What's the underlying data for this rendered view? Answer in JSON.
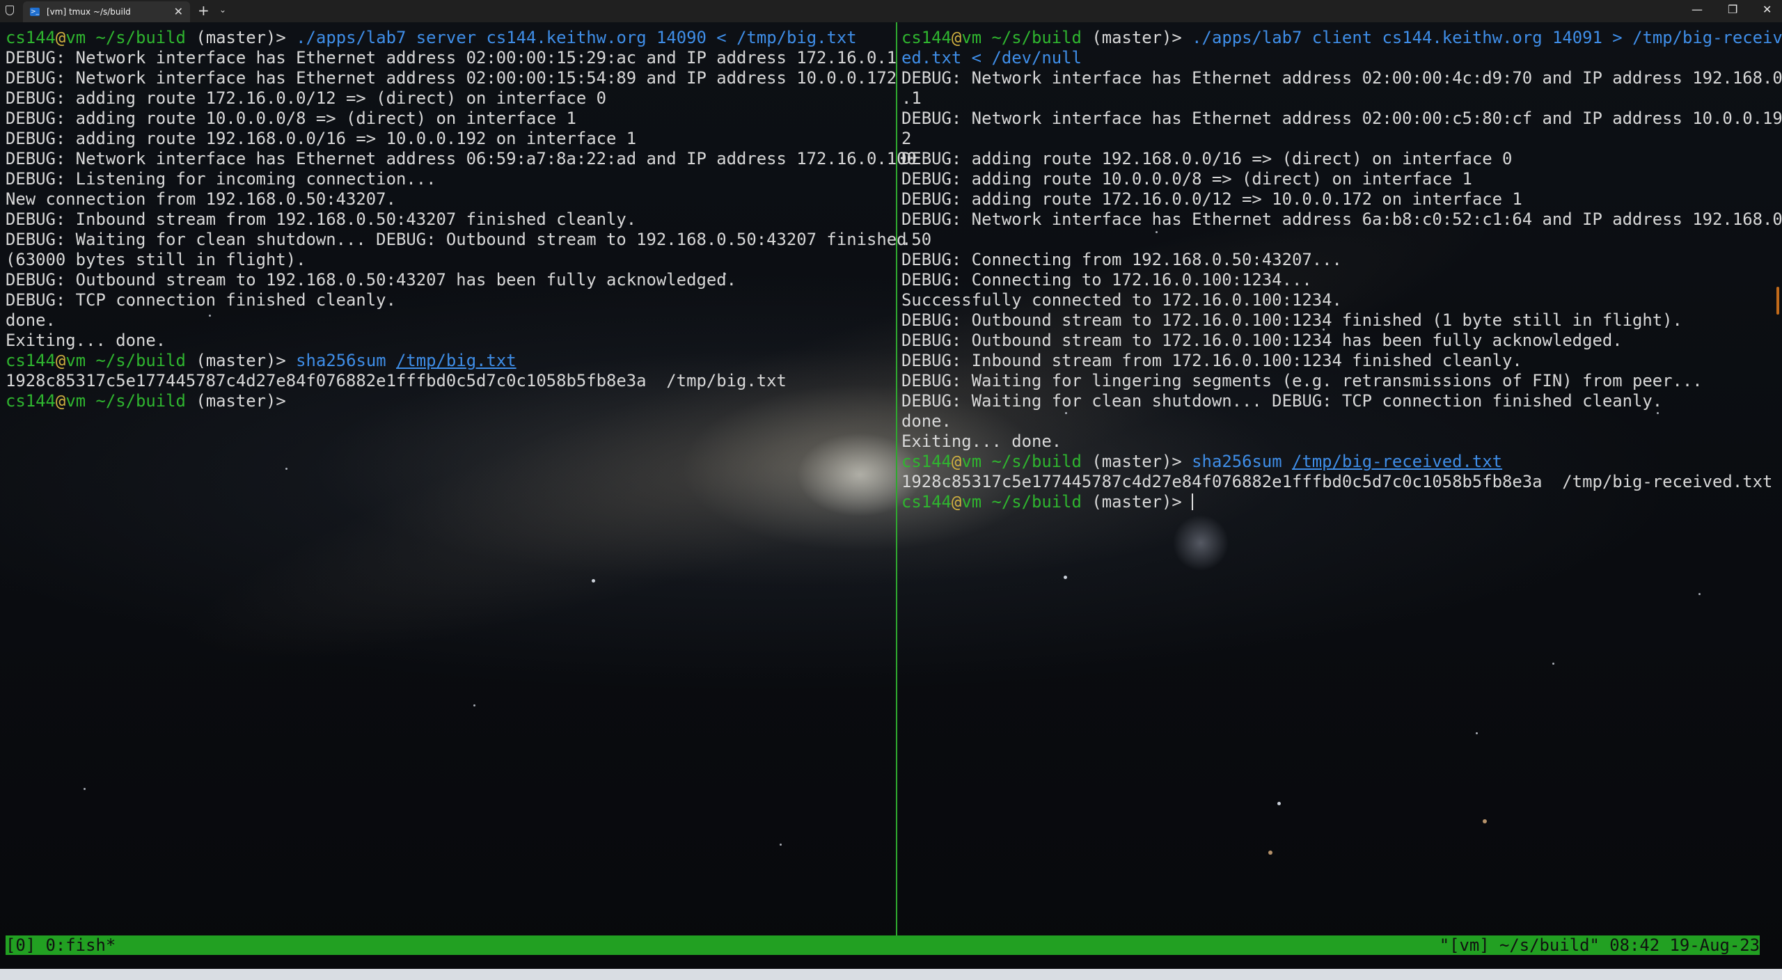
{
  "window": {
    "tab_title": "[vm] tmux ~/s/build",
    "tab_icon_glyph": ">_",
    "close_glyph": "✕",
    "new_tab_glyph": "+",
    "dropdown_glyph": "⌄",
    "minimize_glyph": "—",
    "maximize_glyph": "❐",
    "window_close_glyph": "✕"
  },
  "prompt": {
    "user": "cs144",
    "at": "@",
    "host": "vm",
    "cwd": "~/s/build",
    "branch": "(master)>"
  },
  "left_pane": {
    "cmd1": {
      "program": "./apps/lab7",
      "args": "server cs144.keithw.org 14090",
      "redir": "< /tmp/big.txt"
    },
    "output1": [
      "DEBUG: Network interface has Ethernet address 02:00:00:15:29:ac and IP address 172.16.0.1",
      "DEBUG: Network interface has Ethernet address 02:00:00:15:54:89 and IP address 10.0.0.172",
      "DEBUG: adding route 172.16.0.0/12 => (direct) on interface 0",
      "DEBUG: adding route 10.0.0.0/8 => (direct) on interface 1",
      "DEBUG: adding route 192.168.0.0/16 => 10.0.0.192 on interface 1",
      "DEBUG: Network interface has Ethernet address 06:59:a7:8a:22:ad and IP address 172.16.0.100",
      "DEBUG: Listening for incoming connection...",
      "New connection from 192.168.0.50:43207.",
      "DEBUG: Inbound stream from 192.168.0.50:43207 finished cleanly.",
      "DEBUG: Waiting for clean shutdown... DEBUG: Outbound stream to 192.168.0.50:43207 finished",
      "(63000 bytes still in flight).",
      "DEBUG: Outbound stream to 192.168.0.50:43207 has been fully acknowledged.",
      "DEBUG: TCP connection finished cleanly.",
      "done.",
      "Exiting... done."
    ],
    "cmd2": {
      "program": "sha256sum",
      "file": "/tmp/big.txt"
    },
    "output2": "1928c85317c5e177445787c4d27e84f076882e1fffbd0c5d7c0c1058b5fb8e3a  /tmp/big.txt"
  },
  "right_pane": {
    "cmd1": {
      "program": "./apps/lab7",
      "args": "client cs144.keithw.org 14091",
      "redir": "> /tmp/big-receiv",
      "wrap": "ed.txt < /dev/null"
    },
    "output1": [
      "DEBUG: Network interface has Ethernet address 02:00:00:4c:d9:70 and IP address 192.168.0",
      ".1",
      "DEBUG: Network interface has Ethernet address 02:00:00:c5:80:cf and IP address 10.0.0.19",
      "2",
      "DEBUG: adding route 192.168.0.0/16 => (direct) on interface 0",
      "DEBUG: adding route 10.0.0.0/8 => (direct) on interface 1",
      "DEBUG: adding route 172.16.0.0/12 => 10.0.0.172 on interface 1",
      "DEBUG: Network interface has Ethernet address 6a:b8:c0:52:c1:64 and IP address 192.168.0",
      ".50",
      "DEBUG: Connecting from 192.168.0.50:43207...",
      "DEBUG: Connecting to 172.16.0.100:1234...",
      "Successfully connected to 172.16.0.100:1234.",
      "DEBUG: Outbound stream to 172.16.0.100:1234 finished (1 byte still in flight).",
      "DEBUG: Outbound stream to 172.16.0.100:1234 has been fully acknowledged.",
      "DEBUG: Inbound stream from 172.16.0.100:1234 finished cleanly.",
      "DEBUG: Waiting for lingering segments (e.g. retransmissions of FIN) from peer...",
      "DEBUG: Waiting for clean shutdown... DEBUG: TCP connection finished cleanly.",
      "done.",
      "Exiting... done."
    ],
    "cmd2": {
      "program": "sha256sum",
      "file": "/tmp/big-received.txt"
    },
    "output2": "1928c85317c5e177445787c4d27e84f076882e1fffbd0c5d7c0c1058b5fb8e3a  /tmp/big-received.txt"
  },
  "tmux_status": {
    "left": "[0] 0:fish*",
    "right": "\"[vm] ~/s/build\" 08:42 19-Aug-23"
  },
  "colors": {
    "prompt_green": "#2fb52f",
    "at_yellow": "#d0b040",
    "command_blue": "#3f8ee8",
    "status_bar": "#22a022",
    "pane_divider": "#2fa82f"
  }
}
